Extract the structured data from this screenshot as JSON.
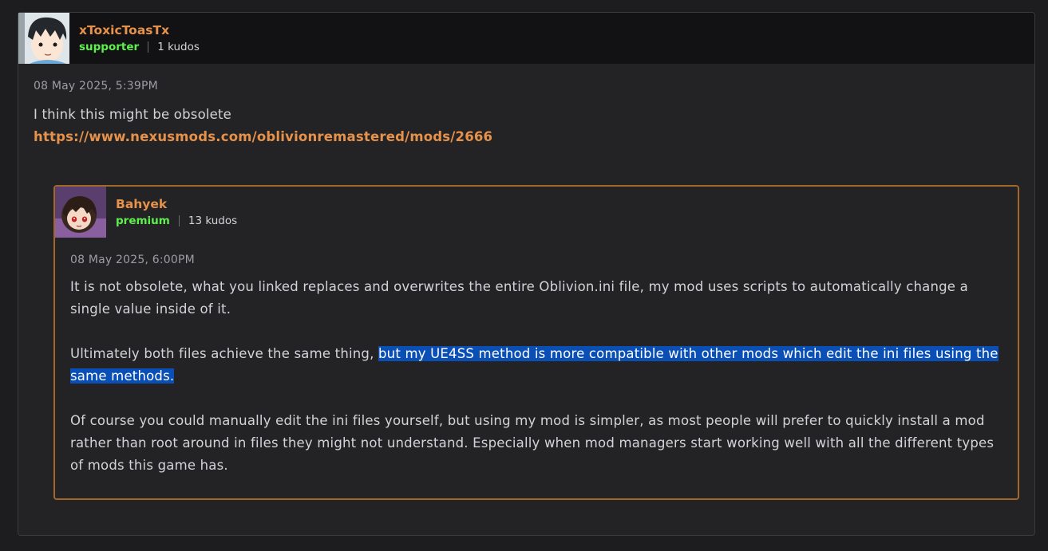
{
  "comment": {
    "author": {
      "name": "xToxicToasTx",
      "role": "supporter",
      "kudos": "1 kudos",
      "avatar_icon": "anime-boy-avatar"
    },
    "timestamp": "08 May 2025, 5:39PM",
    "text": "I think this might be obsolete",
    "link": "https://www.nexusmods.com/oblivionremastered/mods/2666"
  },
  "reply": {
    "author": {
      "name": "Bahyek",
      "role": "premium",
      "kudos": "13 kudos",
      "avatar_icon": "anime-girl-avatar"
    },
    "timestamp": "08 May 2025, 6:00PM",
    "paragraph1": "It is not obsolete, what you linked replaces and overwrites the entire Oblivion.ini file, my mod uses scripts to automatically change a single value inside of it.",
    "paragraph2_plain": "Ultimately both files achieve the same thing, ",
    "paragraph2_selected": "but my UE4SS method is more compatible with other mods which edit the ini files using the same methods.",
    "paragraph3": "Of course you could manually edit the ini files yourself, but using my mod is simpler, as most people will prefer to quickly install a mod rather than root around in files they might not understand. Especially when mod managers start working well with all the different types of mods this game has."
  },
  "colors": {
    "username": "#e7924a",
    "role": "#5ef04d",
    "reply_border": "#a4672b",
    "selection": "#0a4fb5"
  }
}
